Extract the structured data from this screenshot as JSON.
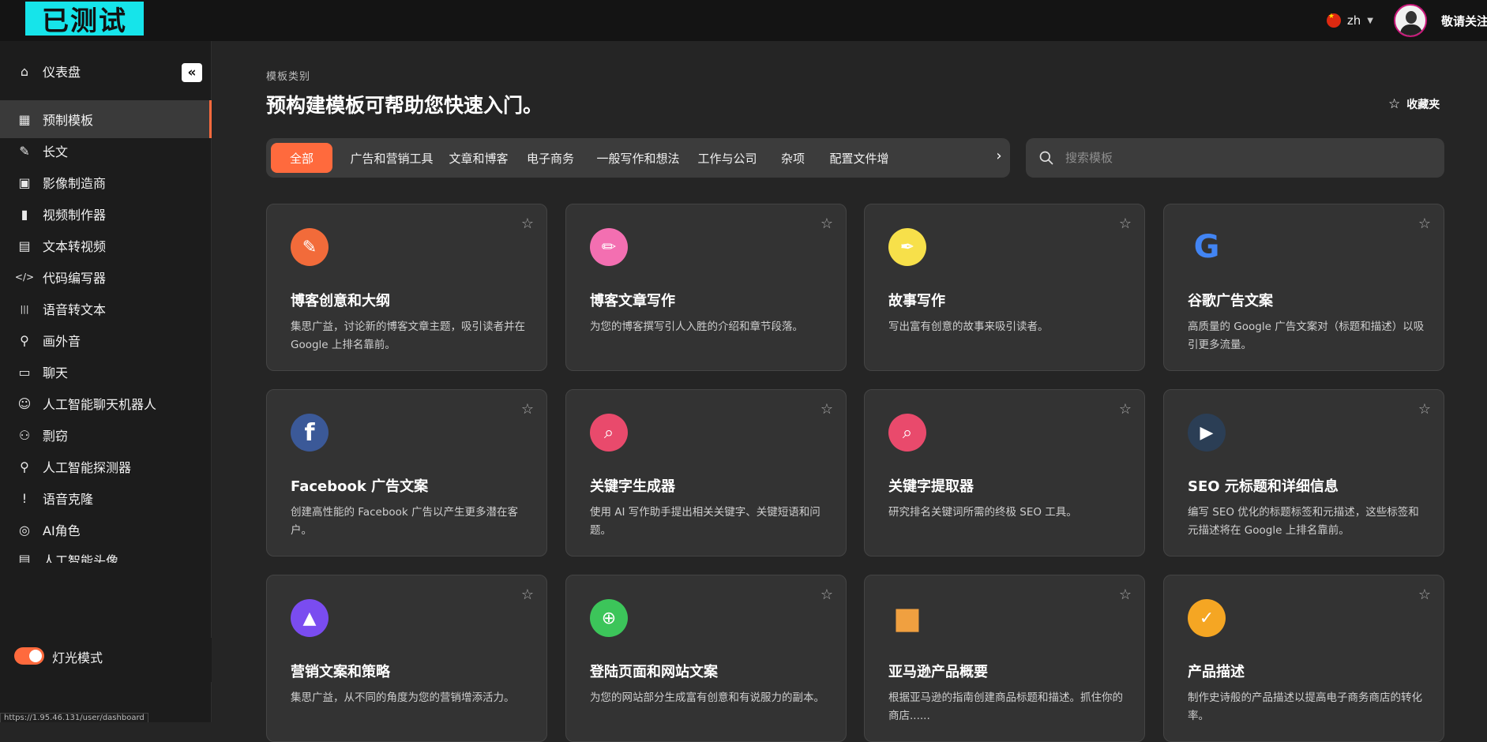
{
  "header": {
    "logo_text": "已测试",
    "language": "zh",
    "username": "敬请关注"
  },
  "sidebar": {
    "collapse_label": "«",
    "items": [
      {
        "label": "仪表盘",
        "icon": "home-icon"
      },
      {
        "label": "预制模板",
        "icon": "dashboard-grid-icon",
        "active": true
      },
      {
        "label": "长文",
        "icon": "pen-icon"
      },
      {
        "label": "影像制造商",
        "icon": "image-icon"
      },
      {
        "label": "视频制作器",
        "icon": "film-icon"
      },
      {
        "label": "文本转视频",
        "icon": "text-video-icon"
      },
      {
        "label": "代码编写器",
        "icon": "code-icon"
      },
      {
        "label": "语音转文本",
        "icon": "waveform-icon"
      },
      {
        "label": "画外音",
        "icon": "microphone-icon"
      },
      {
        "label": "聊天",
        "icon": "chat-icon"
      },
      {
        "label": "人工智能聊天机器人",
        "icon": "robot-icon"
      },
      {
        "label": "剽窃",
        "icon": "plagiarism-icon"
      },
      {
        "label": "人工智能探测器",
        "icon": "detector-icon"
      },
      {
        "label": "语音克隆",
        "icon": "alert-circle-icon"
      },
      {
        "label": "AI角色",
        "icon": "camera-gear-icon"
      },
      {
        "label": "人工智能头像",
        "icon": "avatar-icon"
      }
    ],
    "light_mode_label": "灯光模式",
    "status_url": "https://1.95.46.131/user/dashboard"
  },
  "main": {
    "breadcrumb": "模板类别",
    "title": "预构建模板可帮助您快速入门。",
    "favorites_label": "收藏夹",
    "tabs": [
      "全部",
      "广告和营销工具",
      "文章和博客",
      "电子商务",
      "一般写作和想法",
      "工作与公司",
      "杂项",
      "配置文件增"
    ],
    "search_placeholder": "搜索模板",
    "cards": [
      {
        "title": "博客创意和大纲",
        "desc": "集思广益，讨论新的博客文章主题，吸引读者并在 Google 上排名靠前。",
        "icon": "chat-bubble-icon",
        "icon_bg": "#f26b3a",
        "glyph": "✎"
      },
      {
        "title": "博客文章写作",
        "desc": "为您的博客撰写引人入胜的介绍和章节段落。",
        "icon": "pencil-icon",
        "icon_bg": "#f36fb1",
        "glyph": "✏"
      },
      {
        "title": "故事写作",
        "desc": "写出富有创意的故事来吸引读者。",
        "icon": "quill-icon",
        "icon_bg": "#f7e04a",
        "glyph": "✒"
      },
      {
        "title": "谷歌广告文案",
        "desc": "高质量的 Google 广告文案对（标题和描述）以吸引更多流量。",
        "icon": "google-icon",
        "icon_bg": "transparent",
        "glyph": "G"
      },
      {
        "title": "Facebook 广告文案",
        "desc": "创建高性能的 Facebook 广告以产生更多潜在客户。",
        "icon": "facebook-icon",
        "icon_bg": "#3b5998",
        "glyph": "f"
      },
      {
        "title": "关键字生成器",
        "desc": "使用 AI 写作助手提出相关关键字、关键短语和问题。",
        "icon": "keyword-search-icon",
        "icon_bg": "#e94a6c",
        "glyph": "⌕"
      },
      {
        "title": "关键字提取器",
        "desc": "研究排名关键词所需的终极 SEO 工具。",
        "icon": "keyword-extract-icon",
        "icon_bg": "#e94a6c",
        "glyph": "⌕"
      },
      {
        "title": "SEO 元标题和详细信息",
        "desc": "编写 SEO 优化的标题标签和元描述，这些标签和元描述将在 Google 上排名靠前。",
        "icon": "media-gallery-icon",
        "icon_bg": "#2b3e55",
        "glyph": "▶"
      },
      {
        "title": "营销文案和策略",
        "desc": "集思广益，从不同的角度为您的营销增添活力。",
        "icon": "marketing-shapes-icon",
        "icon_bg": "#7a4cf0",
        "glyph": "▲"
      },
      {
        "title": "登陆页面和网站文案",
        "desc": "为您的网站部分生成富有创意和有说服力的副本。",
        "icon": "globe-icon",
        "icon_bg": "#3cc55a",
        "glyph": "⊕"
      },
      {
        "title": "亚马逊产品概要",
        "desc": "根据亚马逊的指南创建商品标题和描述。抓住你的商店......",
        "icon": "package-box-icon",
        "icon_bg": "transparent",
        "glyph": "■"
      },
      {
        "title": "产品描述",
        "desc": "制作史诗般的产品描述以提高电子商务商店的转化率。",
        "icon": "clipboard-icon",
        "icon_bg": "#f5a623",
        "glyph": "✓"
      }
    ]
  }
}
